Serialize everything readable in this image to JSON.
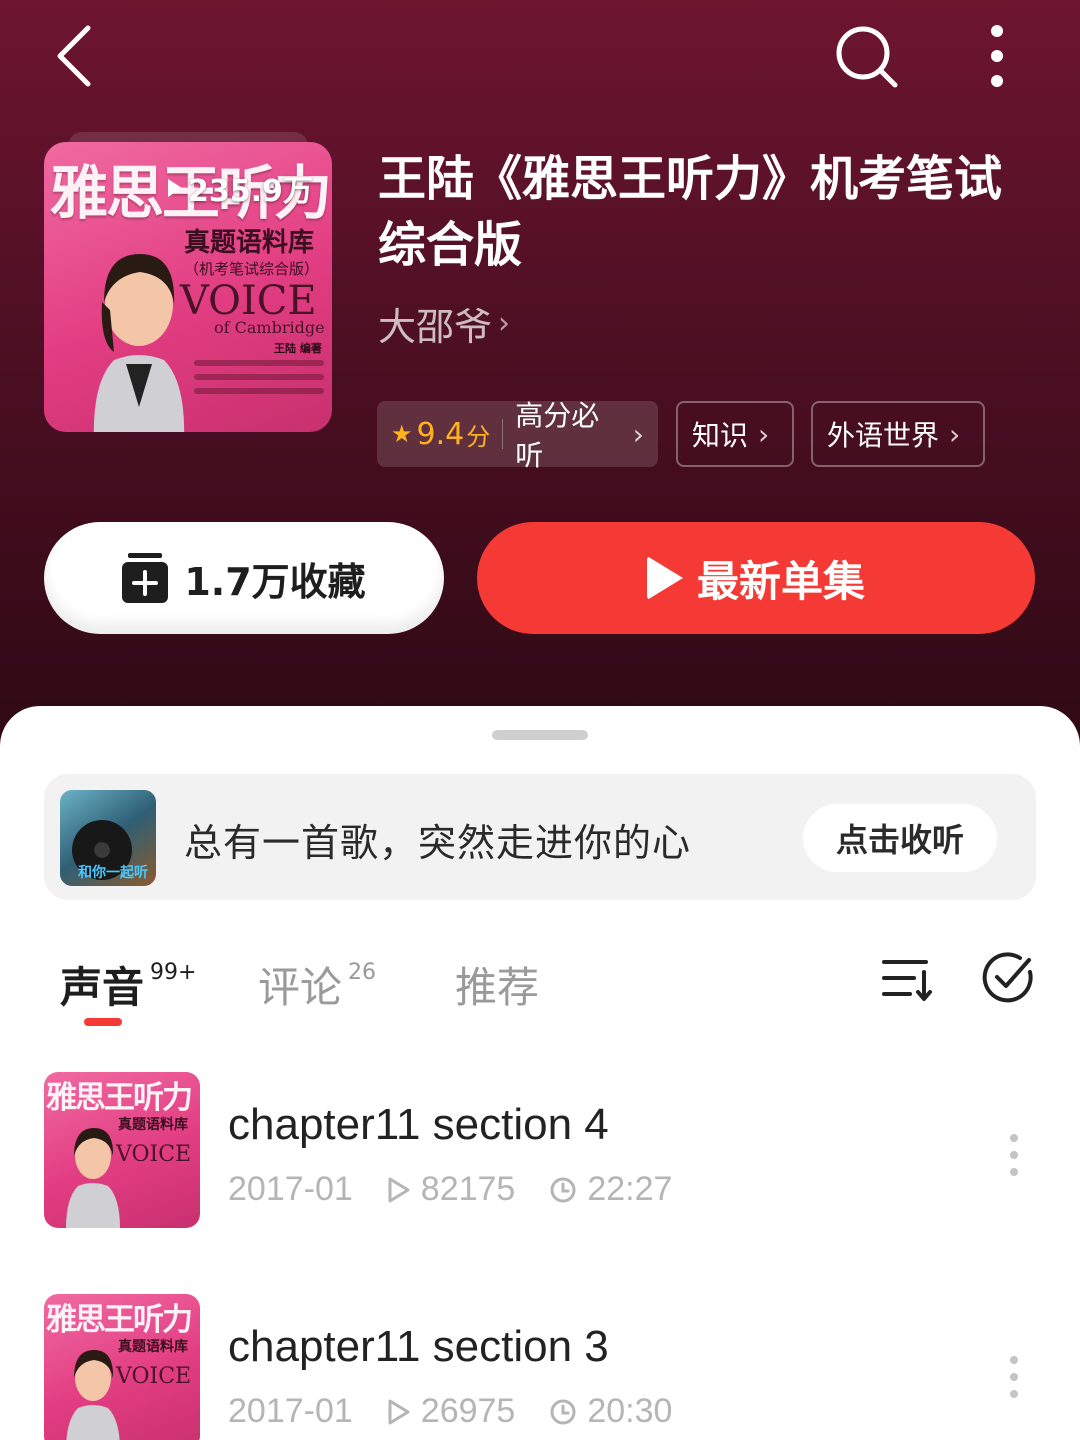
{
  "album": {
    "plays_badge": "235.9万",
    "title": "王陆《雅思王听力》机考笔试综合版",
    "author": "大邵爷",
    "author_chevron": "›",
    "cover": {
      "title": "雅思王听力",
      "subtitle": "真题语料库",
      "edition": "（机考笔试综合版）",
      "voice": "VOICE",
      "of_cambridge": "of Cambridge",
      "author_line": "王陆 编著"
    }
  },
  "tags": {
    "score_value": "9.4",
    "score_unit": "分",
    "score_label": "高分必听",
    "category_1": "知识",
    "category_2": "外语世界",
    "chevron": "›"
  },
  "actions": {
    "collect_label": "1.7万收藏",
    "latest_label": "最新单集"
  },
  "promo": {
    "thumb_text": "和你一起听",
    "text": "总有一首歌，突然走进你的心",
    "button": "点击收听"
  },
  "tabs": [
    {
      "label": "声音",
      "badge": "99+",
      "active": true
    },
    {
      "label": "评论",
      "badge": "26",
      "active": false
    },
    {
      "label": "推荐",
      "badge": "",
      "active": false
    }
  ],
  "tracks": [
    {
      "title": "chapter11 section 4",
      "date": "2017-01",
      "plays": "82175",
      "duration": "22:27"
    },
    {
      "title": "chapter11 section 3",
      "date": "2017-01",
      "plays": "26975",
      "duration": "20:30"
    }
  ],
  "track_thumb": {
    "title": "雅思王听力",
    "subtitle": "真题语料库",
    "voice": "VOICE"
  },
  "colors": {
    "accent_red": "#f53a35",
    "score_gold": "#ffb21e",
    "hero_bg": "#4d0f23"
  },
  "icons": {
    "back": "chevron-left-icon",
    "search": "search-icon",
    "more": "more-vertical-icon",
    "collect": "add-collection-icon",
    "play": "play-icon",
    "sort": "sort-icon",
    "multi_select": "check-circle-icon"
  }
}
